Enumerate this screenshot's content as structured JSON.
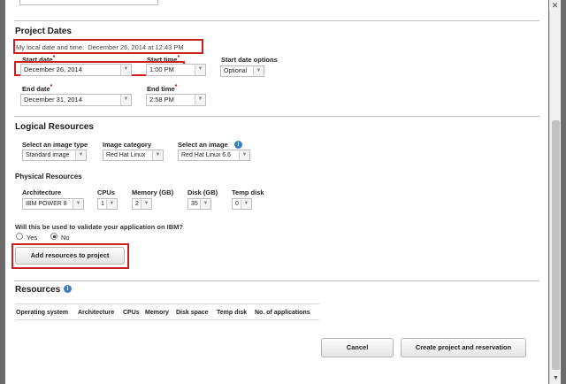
{
  "project_dates": {
    "title": "Project Dates",
    "local_time_label": "My local date and time:",
    "local_time_value": "December 26, 2014 at 12:43 PM",
    "start_date_label": "Start date",
    "start_date_value": "December 26, 2014",
    "start_time_label": "Start time",
    "start_time_value": "1:00 PM",
    "start_options_label": "Start date options",
    "start_options_value": "Optional",
    "end_date_label": "End date",
    "end_date_value": "December 31, 2014",
    "end_time_label": "End time",
    "end_time_value": "2:58 PM",
    "required_mark": "*"
  },
  "logical_resources": {
    "title": "Logical Resources",
    "image_type_label": "Select an image type",
    "image_type_value": "Standard image",
    "image_category_label": "Image category",
    "image_category_value": "Red Hat Linux",
    "image_label": "Select an image",
    "image_value": "Red Hat Linux 6.6"
  },
  "physical_resources": {
    "title": "Physical Resources",
    "architecture_label": "Architecture",
    "architecture_value": "IBM POWER 8",
    "cpus_label": "CPUs",
    "cpus_value": "1",
    "memory_label": "Memory (GB)",
    "memory_value": "2",
    "disk_label": "Disk (GB)",
    "disk_value": "35",
    "temp_disk_label": "Temp disk",
    "temp_disk_value": "0"
  },
  "validate": {
    "question": "Will this be used to validate your application on IBM?",
    "yes_label": "Yes",
    "no_label": "No",
    "selected": "No"
  },
  "add_button_label": "Add resources to project",
  "resources": {
    "title": "Resources",
    "columns": [
      "Operating system",
      "Architecture",
      "CPUs",
      "Memory",
      "Disk space",
      "Temp disk",
      "No. of applications"
    ]
  },
  "footer": {
    "cancel_label": "Cancel",
    "create_label": "Create project and reservation"
  },
  "icons": {
    "info": "info-icon",
    "close": "close-icon",
    "dropdown": "chevron-down-icon"
  },
  "colors": {
    "highlight": "#cc1f1f",
    "info_icon": "#3b7dc4"
  }
}
